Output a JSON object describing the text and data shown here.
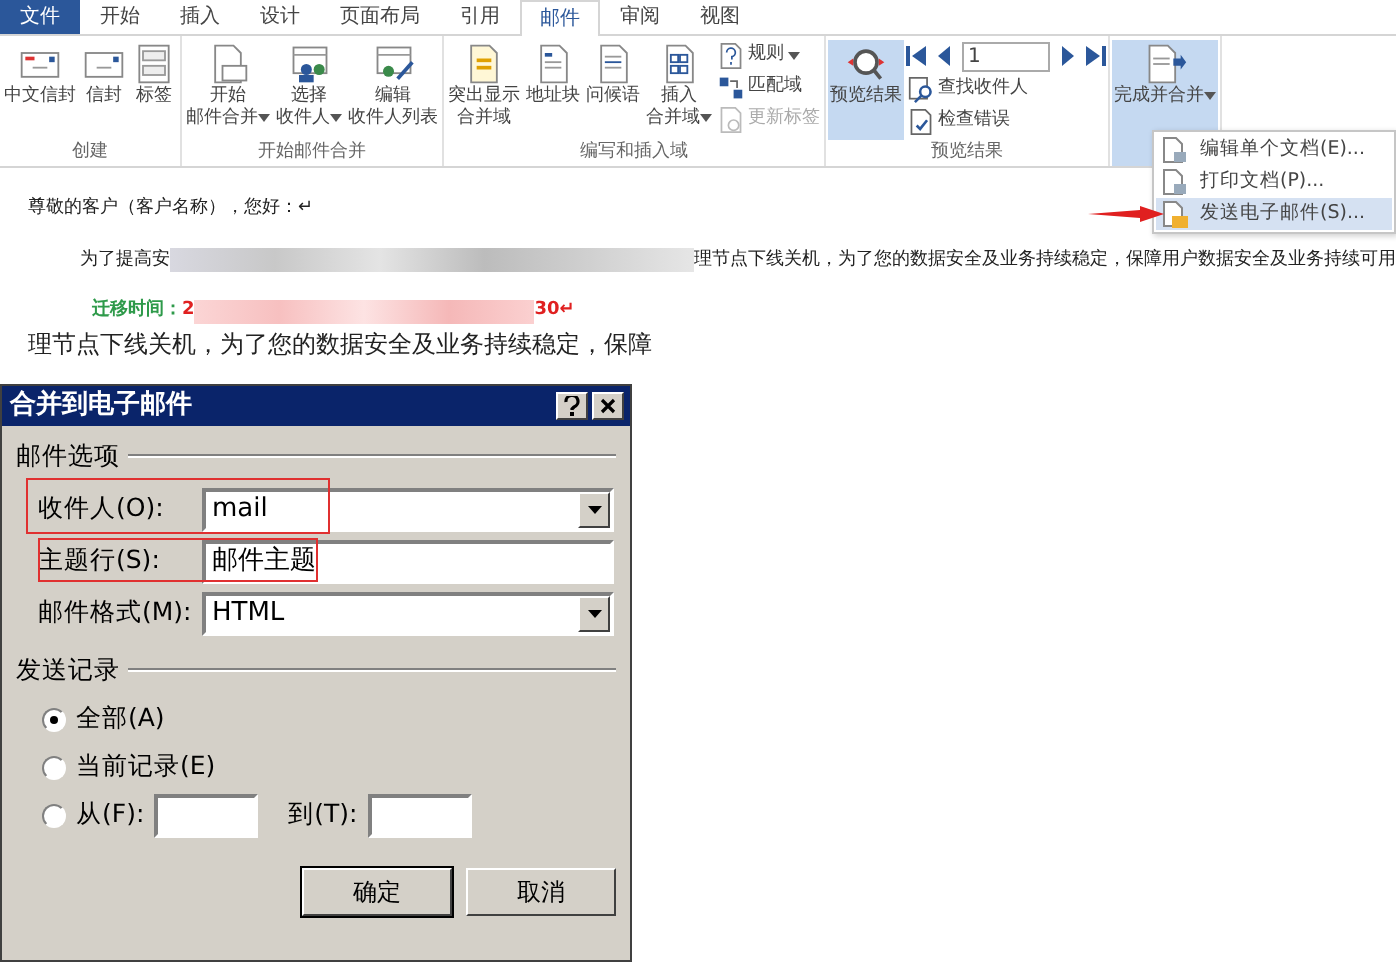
{
  "tabs": [
    {
      "label": "文件",
      "kind": "file",
      "selected": false
    },
    {
      "label": "开始",
      "kind": "tab",
      "selected": false
    },
    {
      "label": "插入",
      "kind": "tab",
      "selected": false
    },
    {
      "label": "设计",
      "kind": "tab",
      "selected": false
    },
    {
      "label": "页面布局",
      "kind": "tab",
      "selected": false
    },
    {
      "label": "引用",
      "kind": "tab",
      "selected": false
    },
    {
      "label": "邮件",
      "kind": "tab",
      "selected": true
    },
    {
      "label": "审阅",
      "kind": "tab",
      "selected": false
    },
    {
      "label": "视图",
      "kind": "tab",
      "selected": false
    }
  ],
  "ribbon": {
    "groups": [
      {
        "label": "创建",
        "buttons": [
          {
            "kind": "large",
            "lines": [
              "中文信封"
            ],
            "dropdown": false,
            "selected": false
          },
          {
            "kind": "large",
            "lines": [
              "信封"
            ],
            "dropdown": false,
            "selected": false
          },
          {
            "kind": "large",
            "lines": [
              "标签"
            ],
            "dropdown": false,
            "selected": false
          }
        ]
      },
      {
        "label": "开始邮件合并",
        "buttons": [
          {
            "kind": "large",
            "lines": [
              "开始",
              "邮件合并"
            ],
            "dropdown": true,
            "selected": false
          },
          {
            "kind": "large",
            "lines": [
              "选择",
              "收件人"
            ],
            "dropdown": true,
            "selected": false
          },
          {
            "kind": "large",
            "lines": [
              "编辑",
              "收件人列表"
            ],
            "dropdown": false,
            "selected": false
          }
        ]
      },
      {
        "label": "编写和插入域",
        "buttons": [
          {
            "kind": "large",
            "lines": [
              "突出显示",
              "合并域"
            ],
            "dropdown": false,
            "selected": false
          },
          {
            "kind": "large",
            "lines": [
              "地址块"
            ],
            "dropdown": false,
            "selected": false
          },
          {
            "kind": "large",
            "lines": [
              "问候语"
            ],
            "dropdown": false,
            "selected": false
          },
          {
            "kind": "large",
            "lines": [
              "插入",
              "合并域"
            ],
            "dropdown": true,
            "selected": false
          },
          {
            "kind": "small",
            "label": "规则",
            "dropdown": true,
            "disabled": false
          },
          {
            "kind": "small",
            "label": "匹配域",
            "dropdown": false,
            "disabled": false
          },
          {
            "kind": "small",
            "label": "更新标签",
            "dropdown": false,
            "disabled": true
          }
        ]
      },
      {
        "label": "预览结果",
        "buttons": [
          {
            "kind": "large",
            "lines": [
              "预览结果"
            ],
            "dropdown": false,
            "selected": true
          },
          {
            "kind": "nav",
            "record": "1"
          },
          {
            "kind": "small",
            "label": "查找收件人",
            "dropdown": false,
            "disabled": false
          },
          {
            "kind": "small",
            "label": "检查错误",
            "dropdown": false,
            "disabled": false
          }
        ]
      },
      {
        "buttons": [
          {
            "kind": "large",
            "lines": [
              "完成并合并"
            ],
            "dropdown": true,
            "selected": true
          }
        ]
      }
    ]
  },
  "menu": {
    "items": [
      {
        "label": "编辑单个文档(E)...",
        "selected": false,
        "marked": false
      },
      {
        "label": "打印文档(P)...",
        "selected": false,
        "marked": false
      },
      {
        "label": "发送电子邮件(S)...",
        "selected": true,
        "marked": true
      }
    ]
  },
  "document": {
    "greeting": "尊敬的客户（客户名称），您好：↵",
    "paragraph_start": "为了提高安",
    "paragraph_end": "理节点下线关机，为了您的数据安全及业务持续稳定，保障用户数据安全及业务持续可用",
    "migration_label": "迁移时间：",
    "migration_start": "2",
    "migration_end": "30↵",
    "background_line": "理节点下线关机，为了您的数据安全及业务持续稳定，保障"
  },
  "dialog": {
    "title": "合并到电子邮件",
    "options_group": "邮件选项",
    "fields": [
      {
        "label": "收件人(O):",
        "kind": "select",
        "value": "mail",
        "annotated": true
      },
      {
        "label": "主题行(S):",
        "kind": "text",
        "value": "邮件主题",
        "annotated": true
      },
      {
        "label": "邮件格式(M):",
        "kind": "select",
        "value": "HTML",
        "annotated": false
      }
    ],
    "records_group": "发送记录",
    "radios": [
      {
        "label": "全部(A)",
        "kind": "plain",
        "selected": true
      },
      {
        "label": "当前记录(E)",
        "kind": "plain",
        "selected": false
      },
      {
        "label": "从(F):",
        "kind": "range",
        "selected": false,
        "to_label": "到(T):"
      }
    ],
    "buttons": [
      {
        "label": "确定",
        "default": true
      },
      {
        "label": "取消",
        "default": false
      }
    ]
  }
}
